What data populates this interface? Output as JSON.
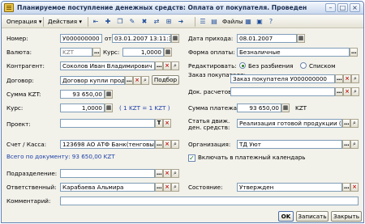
{
  "window": {
    "title": "Планируемое поступление денежных средств: Оплата от покупателя. Проведен",
    "controls": [
      "minimize-icon",
      "maximize-icon",
      "close-icon"
    ]
  },
  "toolbar": {
    "operation_label": "Операция",
    "actions_label": "Действия",
    "files_label": "Файлы",
    "icons": [
      "arrow-left-icon",
      "new-icon",
      "copy-icon",
      "edit-icon",
      "delete-icon",
      "post-icon",
      "structure-icon",
      "go-icon",
      "table-icon",
      "report-icon",
      "help-icon"
    ]
  },
  "form": {
    "number_label": "Номер:",
    "number_value": "У000000000",
    "from_label": "от",
    "date_value": "03.01.2007 13:11:3",
    "arrival_date_label": "Дата прихода:",
    "arrival_date_value": "08.01.2007",
    "currency_label": "Валюта:",
    "currency_value": "KZT",
    "rate_label": "Курс:",
    "rate_value": "1,0000",
    "payment_form_label": "Форма оплаты:",
    "payment_form_value": "Безналичные",
    "counterparty_label": "Контрагент:",
    "counterparty_value": "Соколов Иван Владимирович",
    "edit_label": "Редактировать:",
    "radio_no_split": "Без разбиения",
    "radio_list": "Списком",
    "contract_label": "Договор:",
    "contract_value": "Договор купли прод",
    "select_button": "Подбор",
    "order_label": "Заказ покупателя:",
    "order_value": "Заказ покупателя У000000000",
    "amount_kzt_label": "Сумма KZT:",
    "amount_kzt_value": "93 650,00",
    "settlement_doc_label": "Док. расчетов:",
    "rate2_label": "Курс:",
    "rate2_value": "1,0000",
    "rate_note": "( 1 KZT = 1 KZT )",
    "payment_amount_label": "Сумма платежа:",
    "payment_amount_value": "93 650,00",
    "payment_currency": "KZT",
    "project_label": "Проект:",
    "cashflow_label_1": "Статья движ.",
    "cashflow_label_2": "ден. средств:",
    "cashflow_value": "Реализация готовой продукции (то",
    "account_label": "Счет / Касса:",
    "account_value": "123698 АО АТФ Банк(тенговый)",
    "organization_label": "Организация:",
    "organization_value": "ТД Уют",
    "total_text": "Всего по документу: 93 650,00 KZT",
    "include_calendar_label": "Включать в платежный календарь",
    "include_calendar_checked": true,
    "department_label": "Подразделение:",
    "department_value": "",
    "responsible_label": "Ответственный:",
    "responsible_value": "Карабаева Альмира",
    "state_label": "Состояние:",
    "state_value": "Утвержден",
    "comment_label": "Комментарий:",
    "comment_value": ""
  },
  "footer": {
    "ok_label": "OK",
    "save_label": "Записать",
    "close_label": "Закрыть"
  },
  "colors": {
    "title_gradient_top": "#f4f7fc",
    "title_gradient_bottom": "#c9d8ee",
    "window_bg": "#f2f1ea",
    "field_border": "#7f9db9",
    "blue_text": "#1d3fa8"
  }
}
